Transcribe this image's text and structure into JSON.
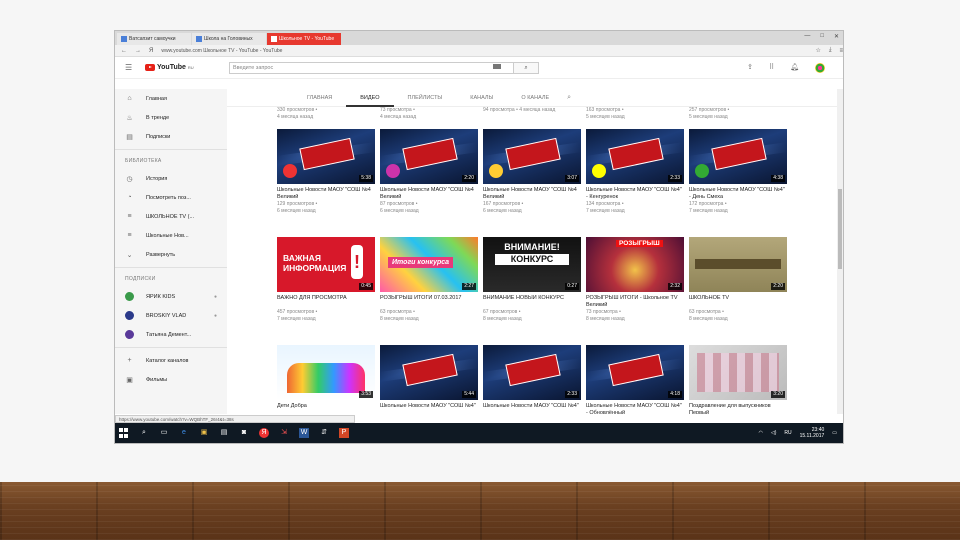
{
  "browser": {
    "tabs": [
      {
        "label": "Ватсапзит самоучки"
      },
      {
        "label": "Школа на Головиных"
      },
      {
        "label": "Школьное TV - YouTube"
      }
    ],
    "window_controls": [
      "—",
      "□",
      "✕"
    ],
    "address": "www.youtube.com   Школьное TV - YouTube - YouTube"
  },
  "youtube": {
    "logo": "YouTube",
    "logo_region": "RU",
    "search_placeholder": "Введите запрос",
    "sidebar": {
      "main": [
        {
          "label": "Главная",
          "icon": "home-icon",
          "glyph": "⌂"
        },
        {
          "label": "В тренде",
          "icon": "trending-icon",
          "glyph": "♨"
        },
        {
          "label": "Подписки",
          "icon": "subscriptions-icon",
          "glyph": "▤"
        }
      ],
      "library_title": "БИБЛИОТЕКА",
      "library": [
        {
          "label": "История",
          "icon": "history-icon",
          "glyph": "◷"
        },
        {
          "label": "Посмотреть поз...",
          "icon": "clock-icon",
          "glyph": "◔"
        },
        {
          "label": "ШКОЛЬНОЕ TV (...",
          "icon": "playlist-icon",
          "glyph": "≡"
        },
        {
          "label": "Школьные Нов...",
          "icon": "playlist-icon",
          "glyph": "≡"
        },
        {
          "label": "Развернуть",
          "icon": "chevron-down-icon",
          "glyph": "⌄"
        }
      ],
      "subs_title": "ПОДПИСКИ",
      "subs": [
        {
          "label": "ЯРИК KIDS",
          "color": "#3a9a4a"
        },
        {
          "label": "BROSKIY VLAD",
          "color": "#2b3a8a"
        },
        {
          "label": "Татьяна Демент...",
          "color": "#5a3a9a"
        }
      ],
      "bottom": [
        {
          "label": "Каталог каналов",
          "icon": "plus-icon",
          "glyph": "+"
        },
        {
          "label": "Фильмы",
          "icon": "film-icon",
          "glyph": "▣"
        }
      ]
    },
    "channel_tabs": [
      "ГЛАВНАЯ",
      "ВИДЕО",
      "ПЛЕЙЛИСТЫ",
      "КАНАЛЫ",
      "О КАНАЛЕ"
    ],
    "active_tab": "ВИДЕО",
    "partial_row": [
      {
        "views": "330 просмотров •",
        "ago": "4 месяца назад"
      },
      {
        "views": "73 просмотра •",
        "ago": "4 месяца назад"
      },
      {
        "views": "94 просмотра • 4 месяца назад",
        "ago": ""
      },
      {
        "views": "163 просмотра •",
        "ago": "5 месяцев назад"
      },
      {
        "views": "257 просмотров •",
        "ago": "5 месяцев назад"
      }
    ],
    "row1": [
      {
        "title": "Школьные Новости МАОУ \"СОШ №4 Великий",
        "views": "129 просмотров •",
        "ago": "6 месяцев назад",
        "dur": "5:38",
        "style": "news",
        "mark": "#e33"
      },
      {
        "title": "Школьные Новости МАОУ \"СОШ №4 Великий",
        "views": "87 просмотров •",
        "ago": "6 месяцев назад",
        "dur": "2:20",
        "style": "news",
        "mark": "#c3a"
      },
      {
        "title": "Школьные Новости МАОУ \"СОШ №4 Великий",
        "views": "167 просмотров •",
        "ago": "6 месяцев назад",
        "dur": "3:07",
        "style": "news",
        "mark": "#fc3"
      },
      {
        "title": "Школьные Новости МАОУ \"СОШ №4\" - Кенгуренок",
        "views": "134 просмотра •",
        "ago": "7 месяцев назад",
        "dur": "2:33",
        "style": "news",
        "mark": "#ff0"
      },
      {
        "title": "Школьные Новости МАОУ \"СОШ №4\" - День Смеха",
        "views": "172 просмотра •",
        "ago": "7 месяцев назад",
        "dur": "4:38",
        "style": "news",
        "mark": "#3a3"
      }
    ],
    "row2": [
      {
        "title": "ВАЖНО ДЛЯ ПРОСМОТРА",
        "views": "457 просмотров •",
        "ago": "7 месяцев назад",
        "dur": "0:45",
        "style": "red",
        "big": "ВАЖНАЯ ИНФОРМАЦИЯ"
      },
      {
        "title": "РОЗЫГРЫШ ИТОГИ 07.03.2017",
        "views": "63 просмотра •",
        "ago": "8 месяцев назад",
        "dur": "2:27",
        "style": "colorful",
        "big": "Итоги конкурса"
      },
      {
        "title": "ВНИМАНИЕ НОВЫЙ КОНКУРС",
        "views": "67 просмотров •",
        "ago": "8 месяцев назад",
        "dur": "0:27",
        "style": "dark",
        "big": "ВНИМАНИЕ!",
        "big2": "КОНКУРС"
      },
      {
        "title": "РОЗЫГРЫШ ИТОГИ - Школьное TV Великий",
        "views": "73 просмотра •",
        "ago": "8 месяцев назад",
        "dur": "2:32",
        "style": "gold",
        "big": "РОЗЫГРЫШ"
      },
      {
        "title": "ШКОЛЬНОЕ TV",
        "views": "63 просмотра •",
        "ago": "8 месяцев назад",
        "dur": "2:20",
        "style": "olive"
      }
    ],
    "row3": [
      {
        "title": "Дети Добра",
        "views": "",
        "ago": "",
        "dur": "3:53",
        "style": "kids"
      },
      {
        "title": "Школьные Новости МАОУ \"СОШ №4\"",
        "views": "",
        "ago": "",
        "dur": "5:44",
        "style": "news"
      },
      {
        "title": "Школьные Новости МАОУ \"СОШ №4\"",
        "views": "",
        "ago": "",
        "dur": "2:33",
        "style": "news"
      },
      {
        "title": "Школьные Новости МАОУ \"СОШ №4\" - Обновлённый",
        "views": "",
        "ago": "",
        "dur": "4:18",
        "style": "news"
      },
      {
        "title": "Поздравление для выпускников Первый",
        "views": "",
        "ago": "",
        "dur": "3:20",
        "style": "photo"
      }
    ],
    "status_url": "https://www.youtube.com/watch?v=WQBhTF_26r4&t=38s"
  },
  "taskbar": {
    "time": "23:40",
    "date": "15.11.2017",
    "lang": "RU"
  }
}
